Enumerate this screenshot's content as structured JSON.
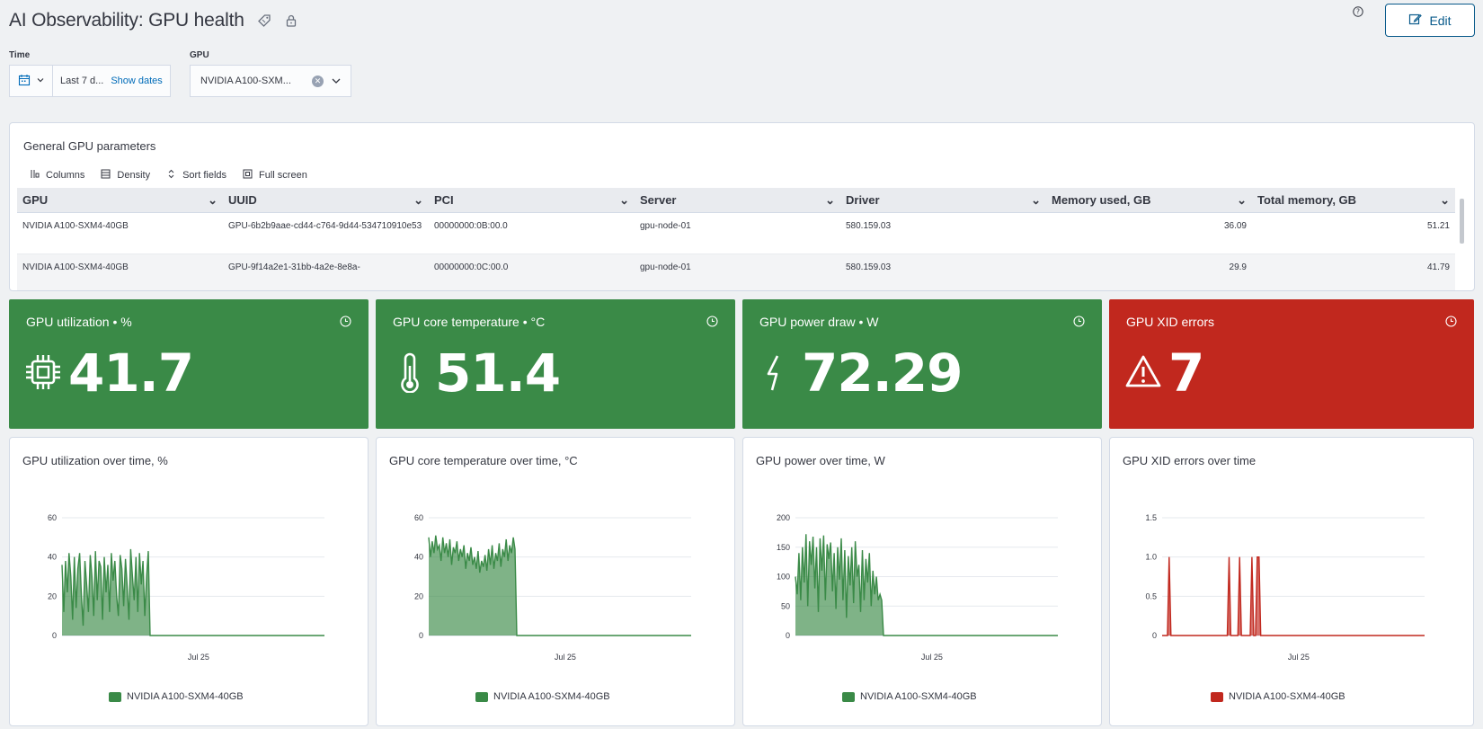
{
  "header": {
    "title": "AI Observability: GPU health",
    "edit_label": "Edit",
    "icons": [
      "tag-icon",
      "lock-icon",
      "help-icon",
      "pencil-icon"
    ]
  },
  "filters": {
    "time": {
      "label": "Time",
      "range": "Last 7 d...",
      "show_dates": "Show dates"
    },
    "gpu": {
      "label": "GPU",
      "value": "NVIDIA A100-SXM..."
    }
  },
  "table": {
    "title": "General GPU parameters",
    "toolbar": {
      "columns": "Columns",
      "density": "Density",
      "sort": "Sort fields",
      "full": "Full screen"
    },
    "headers": [
      "GPU",
      "UUID",
      "PCI",
      "Server",
      "Driver",
      "Memory used, GB",
      "Total memory, GB"
    ],
    "rows": [
      {
        "gpu": "NVIDIA A100-SXM4-40GB",
        "uuid": "GPU-6b2b9aae-cd44-c764-9d44-534710910e53",
        "pci": "00000000:0B:00.0",
        "server": "gpu-node-01",
        "driver": "580.159.03",
        "mem_used": "36.09",
        "mem_total": "51.21"
      },
      {
        "gpu": "NVIDIA A100-SXM4-40GB",
        "uuid": "GPU-9f14a2e1-31bb-4a2e-8e8a-",
        "pci": "00000000:0C:00.0",
        "server": "gpu-node-01",
        "driver": "580.159.03",
        "mem_used": "29.9",
        "mem_total": "41.79"
      }
    ]
  },
  "metrics": [
    {
      "title": "GPU utilization • %",
      "value": "41.7",
      "icon": "chip-icon",
      "status": "green"
    },
    {
      "title": "GPU core temperature • °C",
      "value": "51.4",
      "icon": "thermometer-icon",
      "status": "green"
    },
    {
      "title": "GPU power draw • W",
      "value": "72.29",
      "icon": "bolt-icon",
      "status": "green"
    },
    {
      "title": "GPU XID errors",
      "value": "7",
      "icon": "warning-icon",
      "status": "red"
    }
  ],
  "colors": {
    "green": "#3a8a47",
    "red": "#c1281e",
    "link": "#006bb8"
  },
  "chart_data": [
    {
      "type": "area",
      "title": "GPU utilization over time, %",
      "xlabel": "",
      "ylabel": "",
      "ylim": [
        0,
        60
      ],
      "yticks": [
        "0",
        "20",
        "40",
        "60"
      ],
      "xtick": "Jul 25",
      "legend": "bottom",
      "color": "#3a8a47",
      "series": [
        {
          "name": "NVIDIA A100-SXM4-40GB",
          "values": [
            36,
            12,
            38,
            22,
            42,
            30,
            8,
            40,
            14,
            34,
            42,
            20,
            5,
            38,
            26,
            12,
            41,
            30,
            10,
            43,
            18,
            38,
            35,
            8,
            40,
            22,
            36,
            12,
            42,
            28,
            38,
            20,
            10,
            41,
            34,
            15,
            39,
            25,
            8,
            44,
            30,
            18,
            40,
            12,
            42,
            26,
            38,
            10,
            30,
            43,
            0,
            0,
            0,
            0,
            0,
            0,
            0,
            0,
            0,
            0,
            0,
            0,
            0,
            0,
            0,
            0,
            0,
            0,
            0,
            0,
            0,
            0,
            0,
            0,
            0,
            0,
            0,
            0,
            0,
            0,
            0,
            0,
            0,
            0,
            0,
            0,
            0,
            0,
            0,
            0,
            0,
            0,
            0,
            0,
            0,
            0,
            0,
            0,
            0,
            0,
            0,
            0,
            0,
            0,
            0,
            0,
            0,
            0,
            0,
            0,
            0,
            0,
            0,
            0,
            0,
            0,
            0,
            0,
            0,
            0,
            0,
            0,
            0,
            0,
            0,
            0,
            0,
            0,
            0,
            0,
            0,
            0,
            0,
            0,
            0,
            0,
            0,
            0,
            0,
            0,
            0,
            0,
            0,
            0,
            0,
            0,
            0,
            0,
            0,
            0
          ]
        }
      ]
    },
    {
      "type": "area",
      "title": "GPU core temperature over time, °C",
      "xlabel": "",
      "ylabel": "",
      "ylim": [
        0,
        60
      ],
      "yticks": [
        "0",
        "20",
        "40",
        "60"
      ],
      "xtick": "Jul 25",
      "legend": "bottom",
      "color": "#3a8a47",
      "series": [
        {
          "name": "NVIDIA A100-SXM4-40GB",
          "values": [
            50,
            40,
            48,
            42,
            51,
            44,
            46,
            38,
            50,
            42,
            47,
            40,
            49,
            36,
            45,
            42,
            48,
            38,
            44,
            40,
            46,
            34,
            42,
            38,
            45,
            36,
            40,
            34,
            43,
            32,
            38,
            35,
            41,
            33,
            44,
            36,
            46,
            34,
            42,
            38,
            47,
            35,
            44,
            40,
            49,
            38,
            46,
            42,
            50,
            44,
            0,
            0,
            0,
            0,
            0,
            0,
            0,
            0,
            0,
            0,
            0,
            0,
            0,
            0,
            0,
            0,
            0,
            0,
            0,
            0,
            0,
            0,
            0,
            0,
            0,
            0,
            0,
            0,
            0,
            0,
            0,
            0,
            0,
            0,
            0,
            0,
            0,
            0,
            0,
            0,
            0,
            0,
            0,
            0,
            0,
            0,
            0,
            0,
            0,
            0,
            0,
            0,
            0,
            0,
            0,
            0,
            0,
            0,
            0,
            0,
            0,
            0,
            0,
            0,
            0,
            0,
            0,
            0,
            0,
            0,
            0,
            0,
            0,
            0,
            0,
            0,
            0,
            0,
            0,
            0,
            0,
            0,
            0,
            0,
            0,
            0,
            0,
            0,
            0,
            0,
            0,
            0,
            0,
            0,
            0,
            0,
            0,
            0,
            0,
            0
          ]
        }
      ]
    },
    {
      "type": "area",
      "title": "GPU power over time, W",
      "xlabel": "",
      "ylabel": "",
      "ylim": [
        0,
        200
      ],
      "yticks": [
        "0",
        "50",
        "100",
        "150",
        "200"
      ],
      "xtick": "Jul 25",
      "legend": "bottom",
      "color": "#3a8a47",
      "series": [
        {
          "name": "NVIDIA A100-SXM4-40GB",
          "values": [
            100,
            70,
            140,
            60,
            150,
            90,
            172,
            50,
            160,
            120,
            168,
            80,
            150,
            40,
            165,
            110,
            170,
            60,
            155,
            130,
            158,
            75,
            140,
            45,
            150,
            95,
            165,
            60,
            145,
            30,
            135,
            85,
            150,
            55,
            160,
            100,
            120,
            40,
            145,
            60,
            130,
            90,
            140,
            50,
            110,
            70,
            100,
            60,
            70,
            60,
            0,
            0,
            0,
            0,
            0,
            0,
            0,
            0,
            0,
            0,
            0,
            0,
            0,
            0,
            0,
            0,
            0,
            0,
            0,
            0,
            0,
            0,
            0,
            0,
            0,
            0,
            0,
            0,
            0,
            0,
            0,
            0,
            0,
            0,
            0,
            0,
            0,
            0,
            0,
            0,
            0,
            0,
            0,
            0,
            0,
            0,
            0,
            0,
            0,
            0,
            0,
            0,
            0,
            0,
            0,
            0,
            0,
            0,
            0,
            0,
            0,
            0,
            0,
            0,
            0,
            0,
            0,
            0,
            0,
            0,
            0,
            0,
            0,
            0,
            0,
            0,
            0,
            0,
            0,
            0,
            0,
            0,
            0,
            0,
            0,
            0,
            0,
            0,
            0,
            0,
            0,
            0,
            0,
            0,
            0,
            0,
            0,
            0,
            0,
            0
          ]
        }
      ]
    },
    {
      "type": "area",
      "title": "GPU XID errors over time",
      "xlabel": "",
      "ylabel": "",
      "ylim": [
        0,
        1.5
      ],
      "yticks": [
        "0",
        "0.5",
        "1.0",
        "1.5"
      ],
      "xtick": "Jul 25",
      "legend": "bottom",
      "color": "#c1281e",
      "series": [
        {
          "name": "NVIDIA A100-SXM4-40GB",
          "values": [
            0,
            0,
            0,
            0,
            1,
            0,
            0,
            0,
            0,
            0,
            0,
            0,
            0,
            0,
            0,
            0,
            0,
            0,
            0,
            0,
            0,
            0,
            0,
            0,
            0,
            0,
            0,
            0,
            0,
            0,
            0,
            0,
            0,
            0,
            0,
            0,
            0,
            0,
            1,
            0,
            0,
            0,
            0,
            0,
            1,
            0,
            0,
            0,
            0,
            0,
            0,
            1,
            0,
            0,
            1,
            1,
            0,
            0,
            0,
            0,
            0,
            0,
            0,
            0,
            0,
            0,
            0,
            0,
            0,
            0,
            0,
            0,
            0,
            0,
            0,
            0,
            0,
            0,
            0,
            0,
            0,
            0,
            0,
            0,
            0,
            0,
            0,
            0,
            0,
            0,
            0,
            0,
            0,
            0,
            0,
            0,
            0,
            0,
            0,
            0,
            0,
            0,
            0,
            0,
            0,
            0,
            0,
            0,
            0,
            0,
            0,
            0,
            0,
            0,
            0,
            0,
            0,
            0,
            0,
            0,
            0,
            0,
            0,
            0,
            0,
            0,
            0,
            0,
            0,
            0,
            0,
            0,
            0,
            0,
            0,
            0,
            0,
            0,
            0,
            0,
            0,
            0,
            0,
            0,
            0,
            0,
            0,
            0,
            0,
            0
          ]
        }
      ]
    }
  ]
}
